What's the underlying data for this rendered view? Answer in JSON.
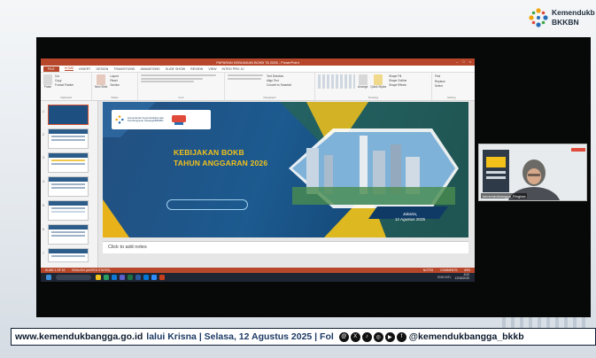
{
  "brand": {
    "line1": "Kemendukb",
    "line2": "BKKBN"
  },
  "ppt": {
    "window_title": "PAPARAN KEBIJAKAN BOKB TA 2026 - PowerPoint",
    "tabs": [
      "FILE",
      "HOME",
      "INSERT",
      "DESIGN",
      "TRANSITIONS",
      "ANIMATIONS",
      "SLIDE SHOW",
      "REVIEW",
      "VIEW",
      "INTRO PRO 10"
    ],
    "ribbon": {
      "paste": "Paste",
      "cut": "Cut",
      "copy": "Copy",
      "format_painter": "Format Painter",
      "new_slide": "New Slide",
      "layout": "Layout",
      "reset": "Reset",
      "section": "Section",
      "text_direction": "Text Direction",
      "align_text": "Align Text",
      "convert_smartart": "Convert to SmartArt",
      "arrange": "Arrange",
      "quick_styles": "Quick Styles",
      "shape_fill": "Shape Fill",
      "shape_outline": "Shape Outline",
      "shape_effects": "Shape Effects",
      "find": "Find",
      "replace": "Replace",
      "select": "Select",
      "groups": [
        "Clipboard",
        "Slides",
        "Font",
        "Paragraph",
        "Drawing",
        "Editing"
      ]
    },
    "slide_numbers": [
      "1",
      "2",
      "3",
      "4",
      "5",
      "6",
      "7"
    ],
    "slide": {
      "title_line1": "KEBIJAKAN BOKB",
      "title_line2": "TAHUN ANGGARAN 2026",
      "location": "Jakarta,",
      "date": "12 Agustus 2025",
      "logo_text": "Kementerian Kependudukan dan Pembangunan Keluarga/BKKBN"
    },
    "notes_placeholder": "Click to add notes",
    "status": {
      "slide_of": "SLIDE 1 OF 15",
      "language": "ENGLISH (UNITED STATES)",
      "notes": "NOTES",
      "comments": "COMMENTS",
      "zoom": "69%"
    },
    "taskbar": {
      "lang": "ENG INTL",
      "time": "8:53",
      "date": "12/08/2025"
    }
  },
  "webcam": {
    "name_tag": "kemendukbangga_Ringkas"
  },
  "ticker": {
    "url": "www.kemendukbangga.go.id",
    "message": "lalui Krisna | Selasa, 12 Agustus 2025 | Fol",
    "handle": "@kemendukbangga_bkkb"
  },
  "colors": {
    "ppt_accent": "#b7472a",
    "slide_title": "#f2c21b",
    "ticker_border": "#0f1e33"
  }
}
